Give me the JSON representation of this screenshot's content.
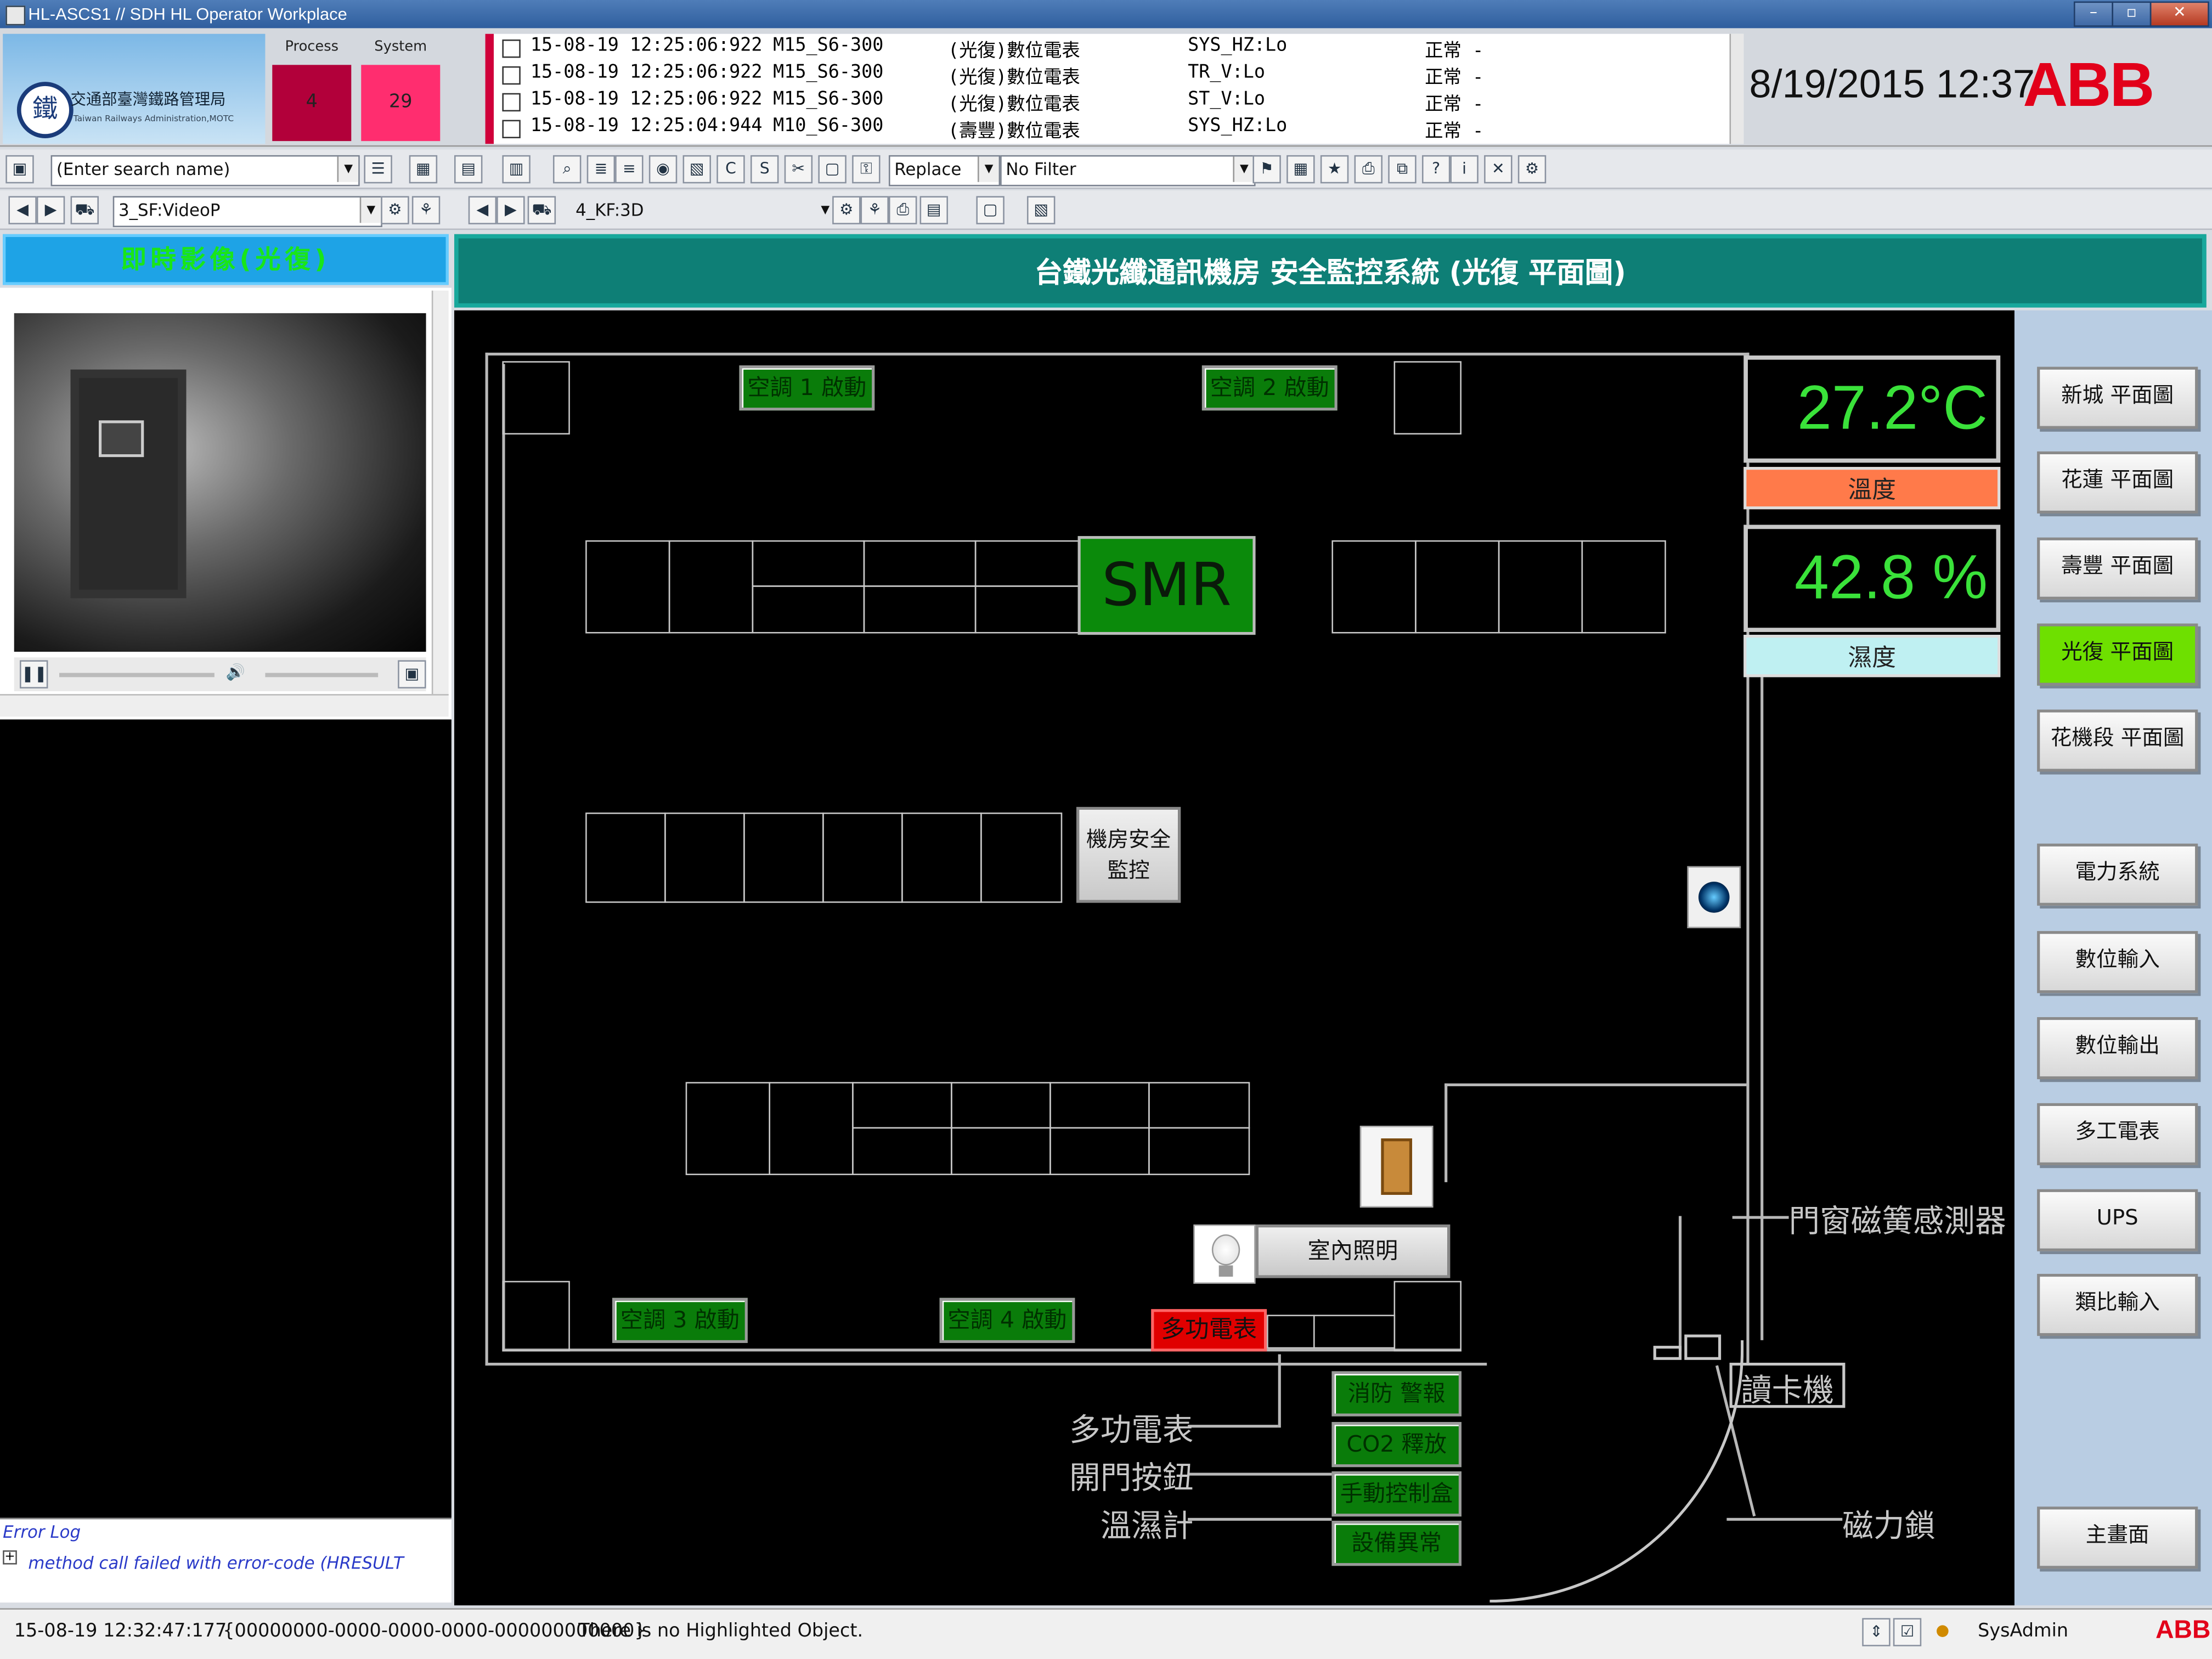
{
  "window": {
    "title": "HL-ASCS1 // SDH HL Operator Workplace"
  },
  "header": {
    "logo_text": "交通部臺灣鐵路管理局",
    "logo_sub": "Taiwan Railways Administration,MOTC",
    "process_label": "Process",
    "process_count": "4",
    "system_label": "System",
    "system_count": "29",
    "clock": "8/19/2015 12:37",
    "brand": "ABB",
    "alarms": [
      {
        "time": "15-08-19 12:25:06:922",
        "object": "M15_S6-300",
        "desc": "(光復)數位電表",
        "signal": "SYS_HZ:Lo",
        "state": "正常 -"
      },
      {
        "time": "15-08-19 12:25:06:922",
        "object": "M15_S6-300",
        "desc": "(光復)數位電表",
        "signal": "TR_V:Lo",
        "state": "正常 -"
      },
      {
        "time": "15-08-19 12:25:06:922",
        "object": "M15_S6-300",
        "desc": "(光復)數位電表",
        "signal": "ST_V:Lo",
        "state": "正常 -"
      },
      {
        "time": "15-08-19 12:25:04:944",
        "object": "M10_S6-300",
        "desc": "(壽豐)數位電表",
        "signal": "SYS_HZ:Lo",
        "state": "正常 -"
      }
    ]
  },
  "toolbar1": {
    "search_placeholder": "(Enter search name)",
    "replace": "Replace",
    "filter": "No Filter"
  },
  "toolbar2": {
    "left_combo": "3_SF:VideoP",
    "right_combo": "4_KF:3D"
  },
  "left": {
    "header": "即時影像(光復)",
    "errlog_title": "Error Log",
    "errlog_msg": "method call failed with error-code (HRESULT"
  },
  "main": {
    "title": "台鐵光纖通訊機房 安全監控系統 (光復 平面圖)",
    "ac1": "空調 1 啟動",
    "ac2": "空調 2 啟動",
    "ac3": "空調 3 啟動",
    "ac4": "空調 4 啟動",
    "smr": "SMR",
    "room_security": "機房安全\n監控",
    "temperature": "27.2°C",
    "temperature_label": "溫度",
    "humidity": "42.8 %",
    "humidity_label": "濕度",
    "indoor_light": "室內照明",
    "power_meter_alarm": "多功電表",
    "fire_alarm": "消防 警報",
    "co2": "CO2 釋放",
    "manual_box": "手動控制盒",
    "equip_fault": "設備異常",
    "ann_meter": "多功電表",
    "ann_door_button": "開門按鈕",
    "ann_thermo": "溫濕計",
    "ann_reed": "門窗磁簧感測器",
    "ann_card": "讀卡機",
    "ann_maglock": "磁力鎖"
  },
  "nav": {
    "items": [
      "新城 平面圖",
      "花蓮 平面圖",
      "壽豐 平面圖",
      "光復 平面圖",
      "花機段 平面圖",
      "電力系統",
      "數位輸入",
      "數位輸出",
      "多工電表",
      "UPS",
      "類比輸入"
    ],
    "active": "光復 平面圖",
    "home": "主畫面"
  },
  "statusbar": {
    "time": "15-08-19 12:32:47:177",
    "guid": "{00000000-0000-0000-0000-000000000000}",
    "message": "There is no Highlighted Object.",
    "user": "SysAdmin",
    "brand": "ABB"
  },
  "colors": {
    "accent_header": "#0e7f76",
    "active_nav": "#6ee000",
    "alarm_red": "#e00000",
    "readout_green": "#3ae23a"
  }
}
